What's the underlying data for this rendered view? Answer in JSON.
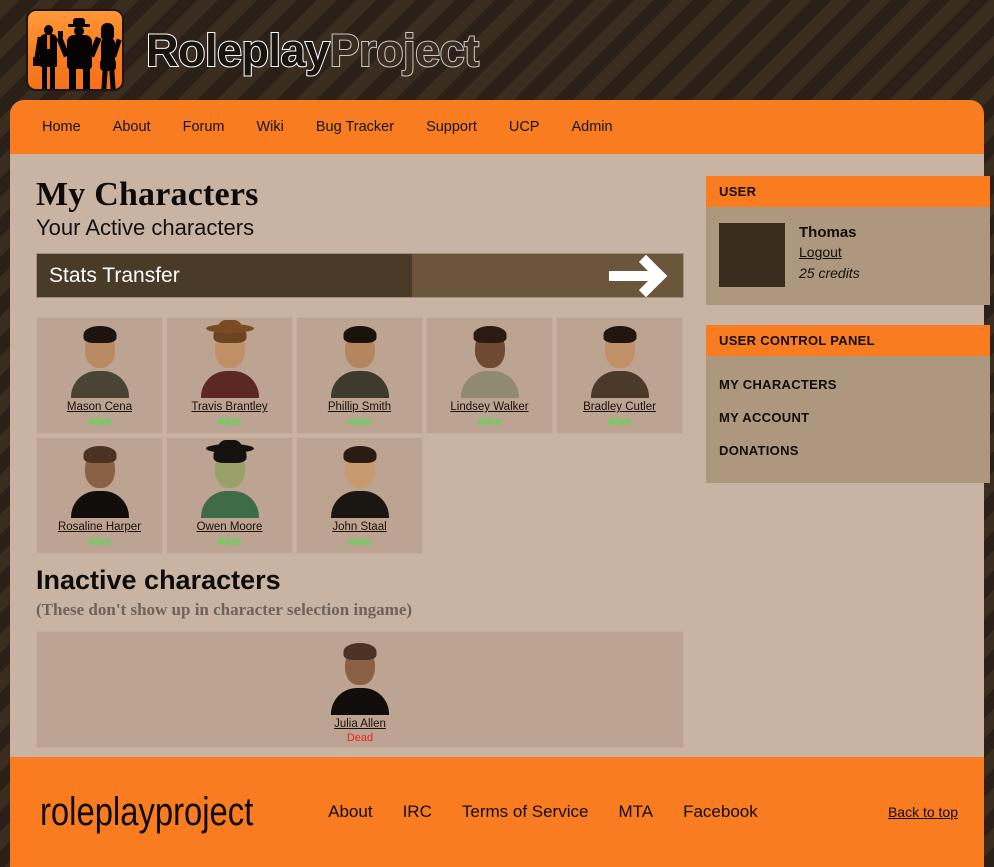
{
  "brand": {
    "part1": "Roleplay",
    "part2": "Project"
  },
  "nav": {
    "items": [
      {
        "label": "Home"
      },
      {
        "label": "About"
      },
      {
        "label": "Forum"
      },
      {
        "label": "Wiki"
      },
      {
        "label": "Bug Tracker"
      },
      {
        "label": "Support"
      },
      {
        "label": "UCP"
      },
      {
        "label": "Admin"
      }
    ]
  },
  "main": {
    "title": "My Characters",
    "subtitle": "Your Active characters",
    "stats_transfer": {
      "label": "Stats Transfer",
      "arrow_icon": "arrow-right-icon"
    },
    "inactive_heading": "Inactive characters",
    "inactive_note": "(These don't show up in character selection ingame)"
  },
  "characters": {
    "active": [
      {
        "name": "Mason Cena",
        "status": "Alive",
        "skin": "asian-male-olive-shirt"
      },
      {
        "name": "Travis Brantley",
        "status": "Alive",
        "skin": "cowboy-plaid-shirt"
      },
      {
        "name": "Phillip Smith",
        "status": "Alive",
        "skin": "asian-male-dark-shirt"
      },
      {
        "name": "Lindsey Walker",
        "status": "Alive",
        "skin": "black-female-cream-top"
      },
      {
        "name": "Bradley Cutler",
        "status": "Alive",
        "skin": "male-brown-sweater"
      },
      {
        "name": "Rosaline Harper",
        "status": "Alive",
        "skin": "female-black-top"
      },
      {
        "name": "Owen Moore",
        "status": "Alive",
        "skin": "male-green-tee-cap"
      },
      {
        "name": "John Staal",
        "status": "Alive",
        "skin": "male-black-vest"
      }
    ],
    "inactive": [
      {
        "name": "Julia Allen",
        "status": "Dead",
        "skin": "female-black-top"
      }
    ]
  },
  "sidebar": {
    "user_panel": {
      "header": "USER",
      "avatar_icon": "user-avatar",
      "username": "Thomas",
      "logout_label": "Logout",
      "credits": "25 credits"
    },
    "ucp_panel": {
      "header": "USER CONTROL PANEL",
      "items": [
        {
          "label": "MY CHARACTERS"
        },
        {
          "label": "MY ACCOUNT"
        },
        {
          "label": "DONATIONS"
        }
      ]
    }
  },
  "footer": {
    "brand": "roleplayproject",
    "links": [
      {
        "label": "About"
      },
      {
        "label": "IRC"
      },
      {
        "label": "Terms of Service"
      },
      {
        "label": "MTA"
      },
      {
        "label": "Facebook"
      }
    ],
    "back_to_top": "Back to top"
  },
  "colors": {
    "accent_orange": "#f97d20",
    "page_bg": "#c9b3a3",
    "card_bg": "#bda492",
    "panel_bg": "#ad977f",
    "stripe_dark": "#2b2018",
    "stripe_light": "#3a2d20",
    "alive": "#37ef37",
    "dead": "#ee2222"
  },
  "skins": {
    "asian-male-olive-shirt": {
      "hair": "#1d1410",
      "face": "#b98a62",
      "torso": "#4a4434"
    },
    "cowboy-plaid-shirt": {
      "hair": "#6d4422",
      "face": "#c09067",
      "torso": "#5c2822",
      "hat": "#7a4c24"
    },
    "asian-male-dark-shirt": {
      "hair": "#1a120d",
      "face": "#b5865e",
      "torso": "#3e3a2c"
    },
    "black-female-cream-top": {
      "hair": "#2a1a10",
      "face": "#6e4a33",
      "torso": "#8f8a70"
    },
    "male-brown-sweater": {
      "hair": "#20160f",
      "face": "#c29168",
      "torso": "#4b3a2a"
    },
    "female-black-top": {
      "hair": "#4a3322",
      "face": "#8a6144",
      "torso": "#100d0b"
    },
    "male-green-tee-cap": {
      "hair": "#141210",
      "face": "#9aa06a",
      "torso": "#3f6b46",
      "hat": "#14110e"
    },
    "male-black-vest": {
      "hair": "#2a1c12",
      "face": "#c79a70",
      "torso": "#1a1612"
    }
  }
}
